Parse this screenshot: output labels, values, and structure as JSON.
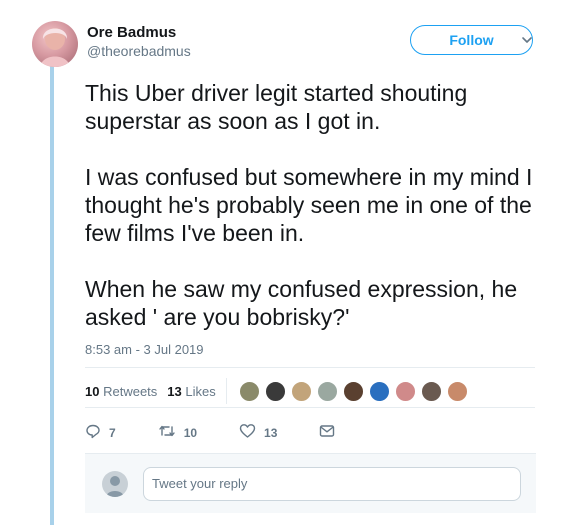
{
  "author": {
    "name": "Ore Badmus",
    "handle": "@theorebadmus"
  },
  "follow_label": "Follow",
  "tweet": {
    "paragraphs": [
      "This Uber driver legit started shouting superstar as soon as I got in.",
      "I was confused but somewhere in my mind I thought he's probably seen me in one of the few films I've been in.",
      "When he saw my confused expression, he asked ' are you bobrisky?'"
    ],
    "timestamp": "8:53 am - 3 Jul 2019"
  },
  "stats": {
    "retweets_count": "10",
    "retweets_label": "Retweets",
    "likes_count": "13",
    "likes_label": "Likes"
  },
  "liker_colors": [
    "#8a8a6a",
    "#3a3a3a",
    "#c2a47a",
    "#9aa8a0",
    "#5a4030",
    "#2a6fbf",
    "#d08a8a",
    "#6a5a50",
    "#c88a6a"
  ],
  "actions": {
    "replies": "7",
    "retweets": "10",
    "likes": "13"
  },
  "reply": {
    "placeholder": "Tweet your reply"
  },
  "colors": {
    "accent": "#1da1f2",
    "thread": "#a8d1ea",
    "muted": "#657786"
  }
}
